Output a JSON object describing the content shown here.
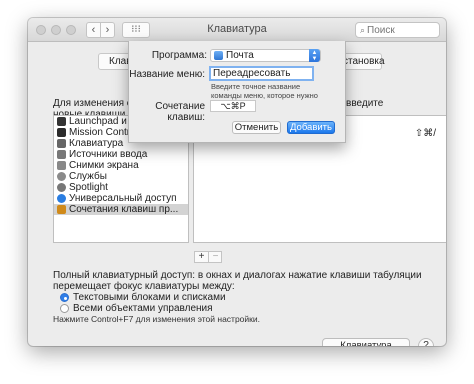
{
  "window": {
    "title": "Клавиатура"
  },
  "toolbar": {
    "back": "‹",
    "forward": "›",
    "grid": "⁝⁝⁝",
    "search_placeholder": "Поиск",
    "search_icon": "⌕"
  },
  "tabs": {
    "left_visible": "Клав",
    "right_visible": "становка"
  },
  "description": {
    "line1": "Для изменения сочета",
    "line2": "новые клавиши.",
    "right_fragment": "введите"
  },
  "categories": [
    {
      "label": "Launchpad и Dock",
      "icon": "launchpad-icon",
      "color": "#333333"
    },
    {
      "label": "Mission Control",
      "icon": "mission-control-icon",
      "color": "#2b2b2b"
    },
    {
      "label": "Клавиатура",
      "icon": "keyboard-icon",
      "color": "#666666"
    },
    {
      "label": "Источники ввода",
      "icon": "input-sources-icon",
      "color": "#777777"
    },
    {
      "label": "Снимки экрана",
      "icon": "screenshot-icon",
      "color": "#888888"
    },
    {
      "label": "Службы",
      "icon": "services-gear-icon",
      "color": "#8a8a8a"
    },
    {
      "label": "Spotlight",
      "icon": "spotlight-icon",
      "color": "#777777"
    },
    {
      "label": "Универсальный доступ",
      "icon": "accessibility-icon",
      "color": "#2a7de1"
    },
    {
      "label": "Сочетания клавиш пр...",
      "icon": "app-shortcuts-icon",
      "color": "#d08a1a",
      "selected": true
    }
  ],
  "shortcut_row": {
    "keys": "⇧⌘/"
  },
  "plus_minus": {
    "plus": "+",
    "minus": "−"
  },
  "keyboard_access": {
    "text": "Полный клавиатурный доступ: в окнах и диалогах нажатие клавиши табуляции перемещает фокус клавиатуры между:",
    "option1": "Текстовыми блоками и списками",
    "option2": "Всеми объектами управления",
    "note": "Нажмите Control+F7 для изменения этой настройки."
  },
  "bottom": {
    "bluetooth_button": "Клавиатура Bluetooth...",
    "help": "?"
  },
  "sheet": {
    "program_label": "Программа:",
    "program_value": "Почта",
    "menu_name_label": "Название меню:",
    "menu_name_value": "Переадресовать",
    "hint": "Введите точное название команды меню, которое нужно добавить.",
    "shortcut_label": "Сочетание клавиш:",
    "shortcut_value": "⌥⌘P",
    "cancel": "Отменить",
    "add": "Добавить"
  },
  "colors": {
    "accent": "#2f7ee8",
    "add_button": "#1b78ec"
  }
}
